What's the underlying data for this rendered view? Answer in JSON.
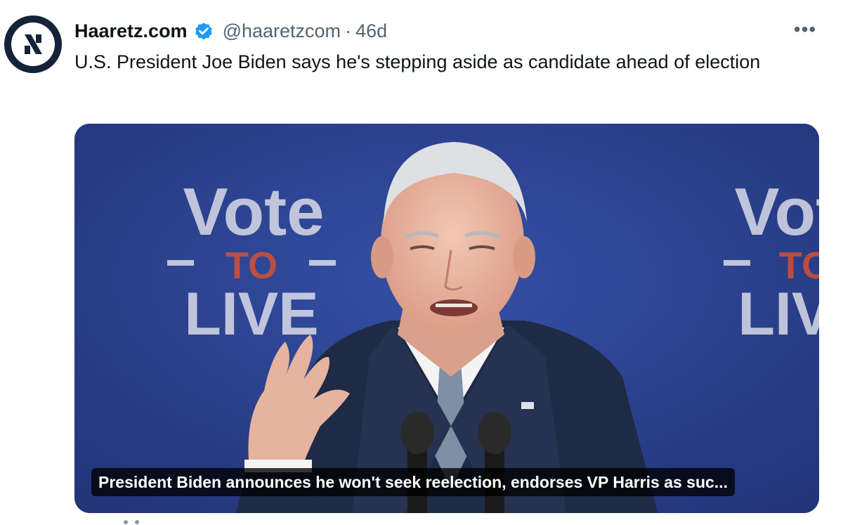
{
  "tweet": {
    "author": {
      "display_name": "Haaretz.com",
      "handle": "@haaretzcom",
      "verified": true,
      "avatar_icon": "haaretz-logo-icon"
    },
    "separator": "·",
    "time": "46d",
    "more_icon": "more-options-icon",
    "text": "U.S. President Joe Biden says he's stepping aside as candidate ahead of election",
    "media": {
      "caption": "President Biden announces he won't seek reelection, endorses VP Harris as suc...",
      "backdrop_lines": [
        "Vote",
        "TO",
        "LIVE"
      ]
    }
  },
  "colors": {
    "verified_badge": "#1d9bf0",
    "backdrop_blue": "#2a3e8d",
    "accent_orange": "#e3522b",
    "text_primary": "#0f1419",
    "text_secondary": "#536471"
  }
}
